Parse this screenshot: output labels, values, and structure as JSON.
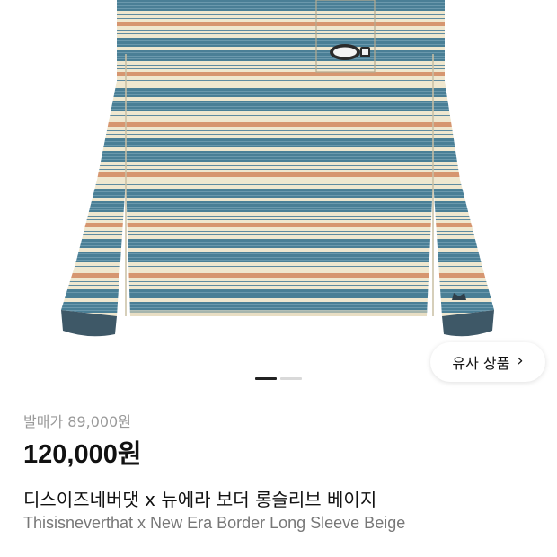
{
  "product": {
    "image_alt": "striped long sleeve",
    "brand_patch_text": "this is never that",
    "colors": {
      "blue": "#4a7f96",
      "cream": "#efe7cf",
      "orange": "#d69670",
      "cuff": "#3e5867"
    }
  },
  "similar_button": {
    "label": "유사 상품",
    "icon": "chevron-right-icon"
  },
  "pager": {
    "count": 2,
    "active_index": 0
  },
  "pricing": {
    "retail_label": "발매가 89,000원",
    "price": "120,000원"
  },
  "names": {
    "korean": "디스이즈네버댓 x 뉴에라 보더 롱슬리브 베이지",
    "english": "Thisisneverthat x New Era Border Long Sleeve Beige"
  }
}
